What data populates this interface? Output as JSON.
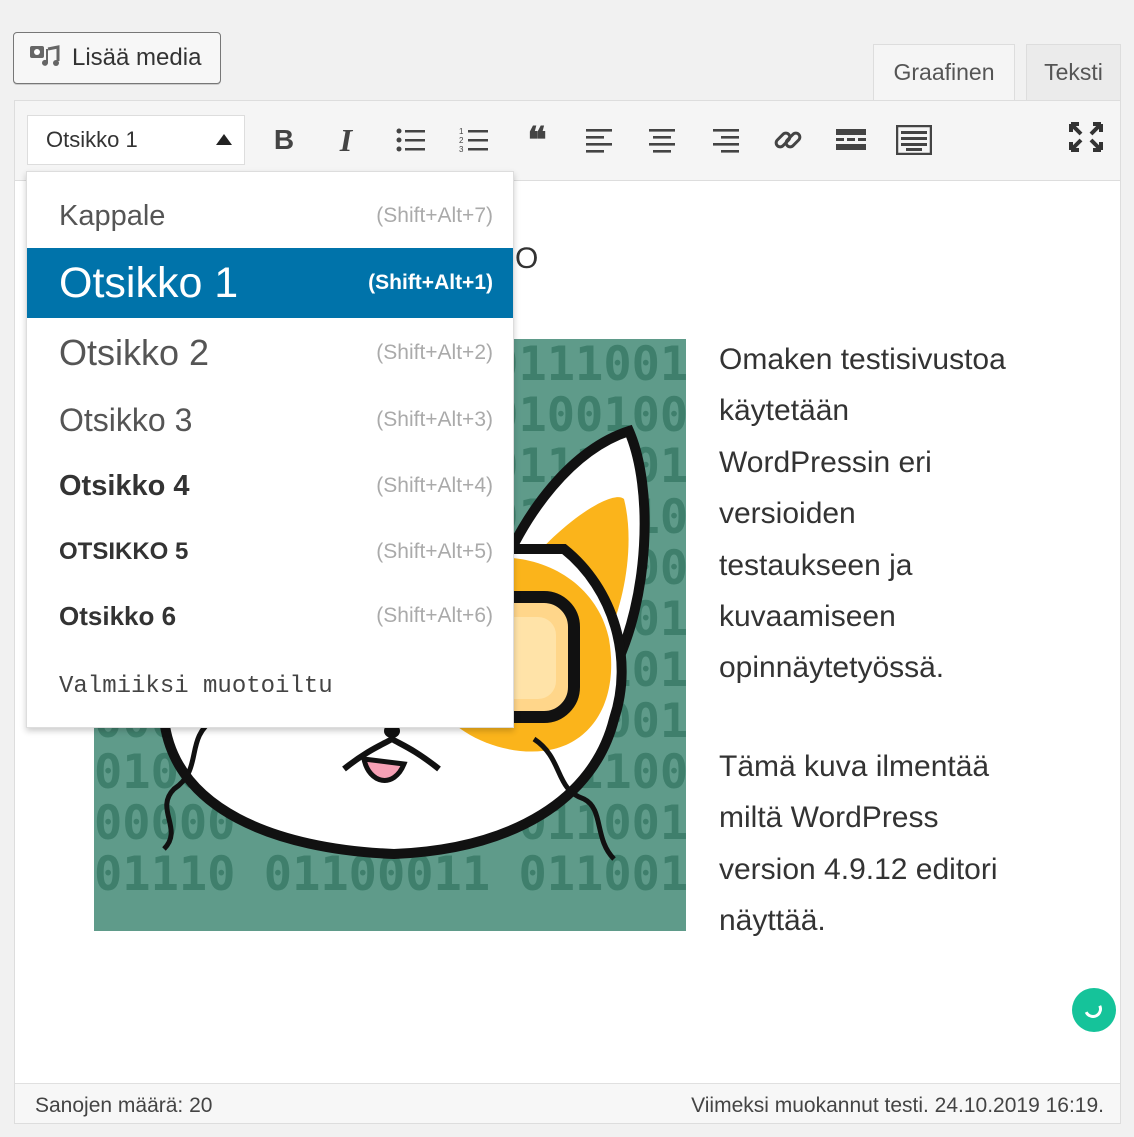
{
  "toolbar_top": {
    "add_media_label": "Lisää media",
    "tabs": [
      {
        "label": "Graafinen",
        "active": true
      },
      {
        "label": "Teksti",
        "active": false
      }
    ]
  },
  "format_toolbar": {
    "format_select_value": "Otsikko 1",
    "buttons": [
      {
        "name": "bold",
        "glyph": "B"
      },
      {
        "name": "italic",
        "glyph": "I"
      },
      {
        "name": "bulleted-list"
      },
      {
        "name": "numbered-list"
      },
      {
        "name": "blockquote",
        "glyph": "❝"
      },
      {
        "name": "align-left"
      },
      {
        "name": "align-center"
      },
      {
        "name": "align-right"
      },
      {
        "name": "link",
        "glyph": "🔗"
      },
      {
        "name": "read-more"
      },
      {
        "name": "toolbar-toggle"
      }
    ],
    "fullscreen_icon": "fullscreen-icon"
  },
  "format_menu": {
    "items": [
      {
        "label": "Kappale",
        "shortcut": "(Shift+Alt+7)"
      },
      {
        "label": "Otsikko 1",
        "shortcut": "(Shift+Alt+1)",
        "selected": true
      },
      {
        "label": "Otsikko 2",
        "shortcut": "(Shift+Alt+2)"
      },
      {
        "label": "Otsikko 3",
        "shortcut": "(Shift+Alt+3)"
      },
      {
        "label": "Otsikko 4",
        "shortcut": "(Shift+Alt+4)"
      },
      {
        "label": "Otsikko 5",
        "shortcut": "(Shift+Alt+5)"
      },
      {
        "label": "Otsikko 6",
        "shortcut": "(Shift+Alt+6)"
      },
      {
        "label": "Valmiiksi muotoiltu",
        "shortcut": ""
      }
    ]
  },
  "content": {
    "heading_visible_tail": "O",
    "paragraph1_lines": [
      "Omaken testisivustoa",
      "käytetään",
      "WordPressin eri",
      "versioiden",
      "testaukseen ja",
      "kuvaamiseen",
      "opinnäytetyössä."
    ],
    "paragraph2_lines": [
      "Tämä kuva ilmentää",
      "miltä WordPress",
      "version 4.9.12 editori",
      "näyttää."
    ],
    "image_binary_rows": [
      "0110 01100011 01110010",
      "1000 01101001 01001000",
      "0011 01100101 01110011",
      "0000 01101110 01101100",
      "0110 01100111 01110000",
      "1000 01110011 01110010",
      "0100 01111010 00111011",
      "0000 01101011 01100010",
      "01001 01100001 01110010",
      "00000 01110011 01100100",
      "01110 01100011 0110010"
    ]
  },
  "status_bar": {
    "word_count": "Sanojen määrä: 20",
    "last_edited": "Viimeksi muokannut testi. 24.10.2019 16:19."
  },
  "colors": {
    "accent": "#0073aa",
    "image_bg": "#5f9b8a",
    "grammarly": "#15c39a"
  }
}
